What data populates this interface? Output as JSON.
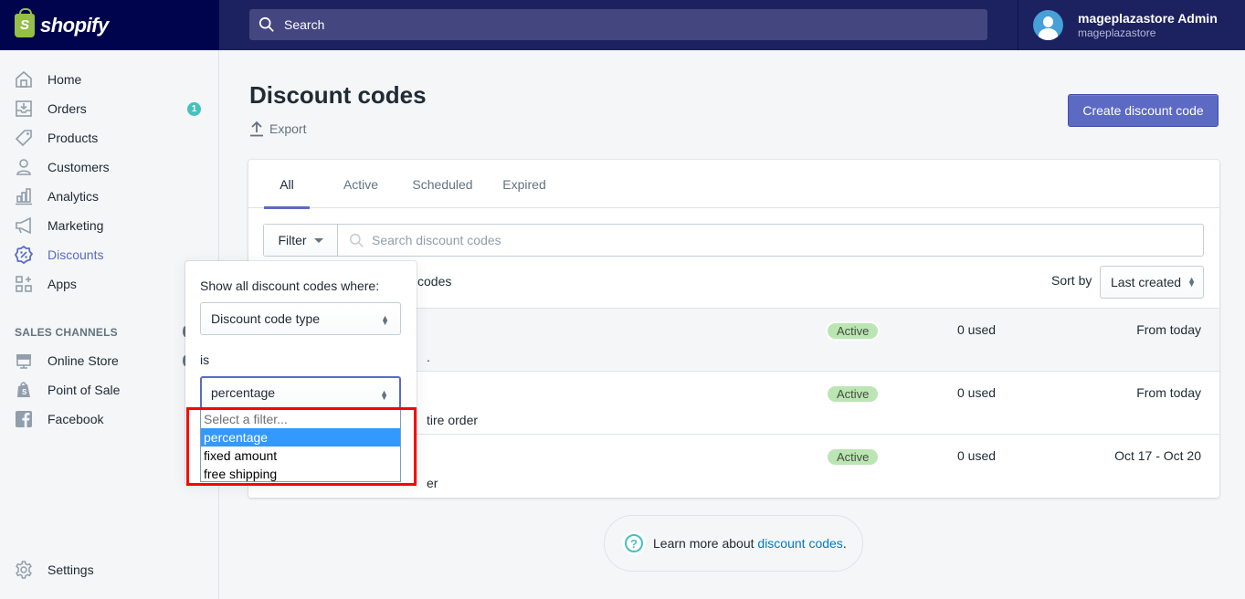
{
  "topbar": {
    "logo_text": "shopify",
    "search_placeholder": "Search",
    "user_name": "mageplazastore Admin",
    "user_store": "mageplazastore"
  },
  "sidebar": {
    "items": [
      {
        "label": "Home",
        "icon": "home-icon"
      },
      {
        "label": "Orders",
        "icon": "orders-icon",
        "badge": "1"
      },
      {
        "label": "Products",
        "icon": "tag-icon"
      },
      {
        "label": "Customers",
        "icon": "person-icon"
      },
      {
        "label": "Analytics",
        "icon": "bar-chart-icon"
      },
      {
        "label": "Marketing",
        "icon": "megaphone-icon"
      },
      {
        "label": "Discounts",
        "icon": "discount-icon",
        "active": true
      },
      {
        "label": "Apps",
        "icon": "apps-icon"
      }
    ],
    "sales_channels_title": "SALES CHANNELS",
    "channels": [
      {
        "label": "Online Store",
        "icon": "store-icon"
      },
      {
        "label": "Point of Sale",
        "icon": "shopping-bag-icon"
      },
      {
        "label": "Facebook",
        "icon": "facebook-icon"
      }
    ],
    "settings_label": "Settings"
  },
  "main": {
    "title": "Discount codes",
    "export_label": "Export",
    "create_button": "Create discount code",
    "tabs": [
      {
        "label": "All",
        "active": true
      },
      {
        "label": "Active"
      },
      {
        "label": "Scheduled"
      },
      {
        "label": "Expired"
      }
    ],
    "filter_label": "Filter",
    "search_placeholder": "Search discount codes",
    "showing_text": "codes",
    "sort_label": "Sort by",
    "sort_value": "Last created",
    "rows": [
      {
        "desc": ".",
        "status": "Active",
        "used": "0 used",
        "date": "From today"
      },
      {
        "desc": "tire order",
        "status": "Active",
        "used": "0 used",
        "date": "From today"
      },
      {
        "desc": "er",
        "status": "Active",
        "used": "0 used",
        "date": "Oct 17 - Oct 20"
      }
    ],
    "help_text": "Learn more about ",
    "help_link": "discount codes",
    "help_suffix": "."
  },
  "filter_popover": {
    "title": "Show all discount codes where:",
    "field_select": "Discount code type",
    "operator": "is",
    "value_select": "percentage",
    "options": [
      {
        "label": "Select a filter...",
        "placeholder": true
      },
      {
        "label": "percentage",
        "selected": true
      },
      {
        "label": "fixed amount"
      },
      {
        "label": "free shipping"
      }
    ]
  },
  "colors": {
    "topbar": "#1c2260",
    "logo_bg": "#00044c",
    "accent": "#5c6ac4",
    "badge": "#47c1bf",
    "status_active": "#bbe5b3",
    "highlight": "#ff0000",
    "option_selected": "#3399ff"
  }
}
